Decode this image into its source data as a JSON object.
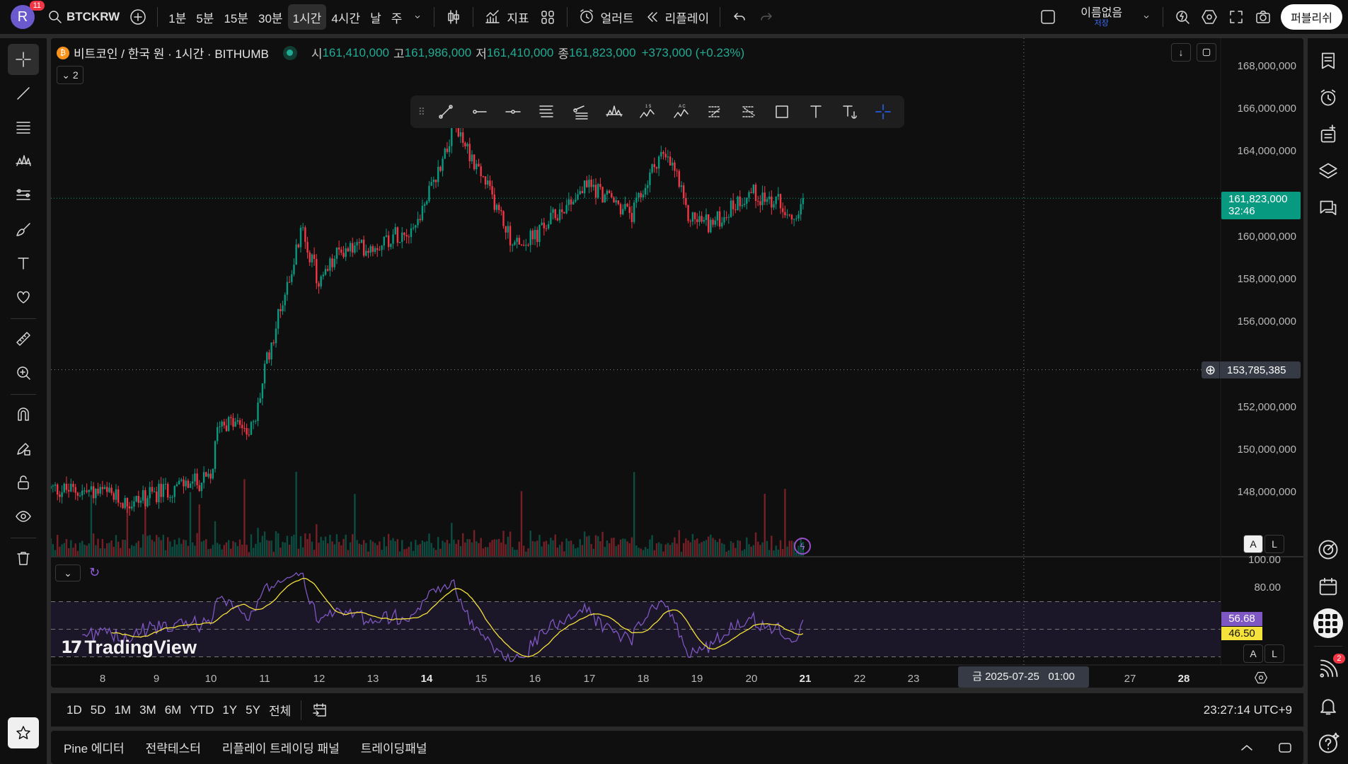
{
  "topbar": {
    "avatar_letter": "R",
    "avatar_badge": "11",
    "symbol": "BTCKRW",
    "intervals": [
      "1분",
      "5분",
      "15분",
      "30분",
      "1시간",
      "4시간",
      "날",
      "주"
    ],
    "active_interval": "1시간",
    "indicators_label": "지표",
    "alert_label": "얼러트",
    "replay_label": "리플레이",
    "layout_name": "이름없음",
    "save_label": "저장",
    "publish_label": "퍼블리쉬"
  },
  "legend": {
    "title": "비트코인 / 한국 원 · 1시간 · BITHUMB",
    "open_label": "시",
    "open": "161,410,000",
    "high_label": "고",
    "high": "161,986,000",
    "low_label": "저",
    "low": "161,410,000",
    "close_label": "종",
    "close": "161,823,000",
    "change": "+373,000 (+0.23%)",
    "collapse_count": "2"
  },
  "price_axis": {
    "ticks": [
      "168,000,000",
      "166,000,000",
      "164,000,000",
      "160,000,000",
      "158,000,000",
      "156,000,000",
      "152,000,000",
      "150,000,000",
      "148,000,000"
    ],
    "last_price": "161,823,000",
    "countdown": "32:46",
    "crosshair_price": "153,785,385",
    "auto_label": "A",
    "log_label": "L"
  },
  "rsi_axis": {
    "ticks": [
      "100.00",
      "80.00"
    ],
    "rsi_value": "56.68",
    "rsi_ma_value": "46.50",
    "auto_label": "A",
    "log_label": "L"
  },
  "time_axis": {
    "ticks": [
      "8",
      "9",
      "10",
      "11",
      "12",
      "13",
      "14",
      "15",
      "16",
      "17",
      "18",
      "19",
      "20",
      "21",
      "22",
      "23",
      "27",
      "28"
    ],
    "crosshair_time": "금 2025-07-25   01:00"
  },
  "watermark": "TradingView",
  "range_bar": {
    "ranges": [
      "1D",
      "5D",
      "1M",
      "3M",
      "6M",
      "YTD",
      "1Y",
      "5Y",
      "전체"
    ],
    "clock": "23:27:14 UTC+9"
  },
  "bottom_panel": {
    "tabs": [
      "Pine 에디터",
      "전략테스터",
      "리플레이 트레이딩 패널",
      "트레이딩패널"
    ]
  },
  "right_sidebar": {
    "notifications_badge": "2"
  },
  "colors": {
    "up": "#089981",
    "down": "#f23645",
    "rsi": "#7e57c2",
    "rsi_ma": "#f5e23a",
    "accent": "#2962ff"
  },
  "chart_data": {
    "type": "candlestick",
    "title": "BTCKRW 1H BITHUMB",
    "x_unit": "day of month (July 2025)",
    "y_unit": "KRW (millions)",
    "ylim": [
      146.3,
      169.0
    ],
    "xlim": [
      7.04,
      28.9
    ],
    "price_path": [
      [
        7.04,
        148.2
      ],
      [
        8,
        148.0
      ],
      [
        8.5,
        147.5
      ],
      [
        9,
        148.0
      ],
      [
        9.5,
        148.4
      ],
      [
        10,
        148.6
      ],
      [
        10.15,
        151.4
      ],
      [
        10.8,
        151.0
      ],
      [
        11,
        153.8
      ],
      [
        11.3,
        156.8
      ],
      [
        11.7,
        160.4
      ],
      [
        12,
        157.8
      ],
      [
        12.4,
        159.4
      ],
      [
        13,
        159.6
      ],
      [
        13.8,
        160.6
      ],
      [
        14.2,
        163.1
      ],
      [
        14.5,
        165.3
      ],
      [
        14.8,
        163.9
      ],
      [
        15.3,
        161.4
      ],
      [
        15.6,
        159.6
      ],
      [
        16,
        160.0
      ],
      [
        16.5,
        161.4
      ],
      [
        17,
        162.5
      ],
      [
        17.8,
        161.0
      ],
      [
        18.3,
        163.9
      ],
      [
        18.6,
        163.1
      ],
      [
        18.8,
        161.0
      ],
      [
        19.3,
        160.6
      ],
      [
        19.8,
        161.8
      ],
      [
        20,
        162.1
      ],
      [
        20.5,
        161.6
      ],
      [
        20.8,
        161.2
      ],
      [
        20.96,
        161.823
      ]
    ],
    "last_close": 161.823,
    "crosshair": {
      "day": 25.04,
      "price": 153.785385
    },
    "rsi": {
      "period": 14,
      "levels": [
        30,
        50,
        70
      ],
      "last": 56.68,
      "ma_last": 46.5
    }
  }
}
